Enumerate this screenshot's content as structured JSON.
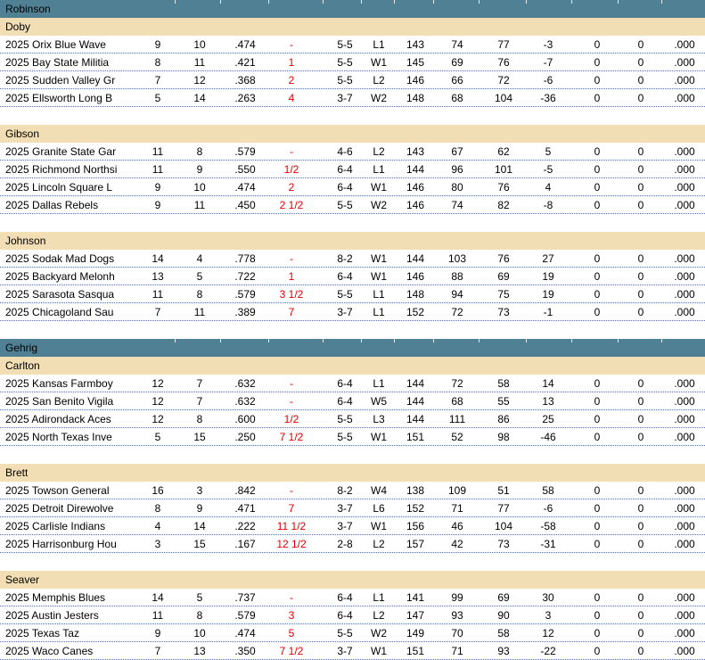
{
  "colors": {
    "league_band": "#4f8094",
    "division_band": "#f2deb4",
    "games_behind": "#e00000",
    "row_separator": "#5b6fb0"
  },
  "leagues": [
    {
      "name": "Robinson",
      "divisions": [
        {
          "name": "Doby",
          "teams": [
            [
              "2025 Orix  Blue Wave",
              "9",
              "10",
              ".474",
              "-",
              "5-5",
              "L1",
              "143",
              "74",
              "77",
              "-3",
              "0",
              "0",
              ".000"
            ],
            [
              "2025 Bay State Militia",
              "8",
              "11",
              ".421",
              "1",
              "5-5",
              "W1",
              "145",
              "69",
              "76",
              "-7",
              "0",
              "0",
              ".000"
            ],
            [
              "2025 Sudden Valley Gr",
              "7",
              "12",
              ".368",
              "2",
              "5-5",
              "L2",
              "146",
              "66",
              "72",
              "-6",
              "0",
              "0",
              ".000"
            ],
            [
              "2025 Ellsworth Long B",
              "5",
              "14",
              ".263",
              "4",
              "3-7",
              "W2",
              "148",
              "68",
              "104",
              "-36",
              "0",
              "0",
              ".000"
            ]
          ]
        },
        {
          "name": "Gibson",
          "teams": [
            [
              "2025 Granite State Gar",
              "11",
              "8",
              ".579",
              "-",
              "4-6",
              "L2",
              "143",
              "67",
              "62",
              "5",
              "0",
              "0",
              ".000"
            ],
            [
              "2025 Richmond Northsi",
              "11",
              "9",
              ".550",
              "1/2",
              "6-4",
              "L1",
              "144",
              "96",
              "101",
              "-5",
              "0",
              "0",
              ".000"
            ],
            [
              "2025 Lincoln Square L",
              "9",
              "10",
              ".474",
              "2",
              "6-4",
              "W1",
              "146",
              "80",
              "76",
              "4",
              "0",
              "0",
              ".000"
            ],
            [
              "2025 Dallas Rebels",
              "9",
              "11",
              ".450",
              "2 1/2",
              "5-5",
              "W2",
              "146",
              "74",
              "82",
              "-8",
              "0",
              "0",
              ".000"
            ]
          ]
        },
        {
          "name": "Johnson",
          "teams": [
            [
              "2025 Sodak Mad Dogs",
              "14",
              "4",
              ".778",
              "-",
              "8-2",
              "W1",
              "144",
              "103",
              "76",
              "27",
              "0",
              "0",
              ".000"
            ],
            [
              "2025 Backyard Melonh",
              "13",
              "5",
              ".722",
              "1",
              "6-4",
              "W1",
              "146",
              "88",
              "69",
              "19",
              "0",
              "0",
              ".000"
            ],
            [
              "2025 Sarasota Sasqua",
              "11",
              "8",
              ".579",
              "3 1/2",
              "5-5",
              "L1",
              "148",
              "94",
              "75",
              "19",
              "0",
              "0",
              ".000"
            ],
            [
              "2025 Chicagoland Sau",
              "7",
              "11",
              ".389",
              "7",
              "3-7",
              "L1",
              "152",
              "72",
              "73",
              "-1",
              "0",
              "0",
              ".000"
            ]
          ]
        }
      ]
    },
    {
      "name": "Gehrig",
      "divisions": [
        {
          "name": "Carlton",
          "teams": [
            [
              "2025 Kansas Farmboy",
              "12",
              "7",
              ".632",
              "-",
              "6-4",
              "L1",
              "144",
              "72",
              "58",
              "14",
              "0",
              "0",
              ".000"
            ],
            [
              "2025 San Benito Vigila",
              "12",
              "7",
              ".632",
              "-",
              "6-4",
              "W5",
              "144",
              "68",
              "55",
              "13",
              "0",
              "0",
              ".000"
            ],
            [
              "2025 Adirondack Aces",
              "12",
              "8",
              ".600",
              "1/2",
              "5-5",
              "L3",
              "144",
              "111",
              "86",
              "25",
              "0",
              "0",
              ".000"
            ],
            [
              "2025 North Texas Inve",
              "5",
              "15",
              ".250",
              "7 1/2",
              "5-5",
              "W1",
              "151",
              "52",
              "98",
              "-46",
              "0",
              "0",
              ".000"
            ]
          ]
        },
        {
          "name": "Brett",
          "teams": [
            [
              "2025 Towson  General",
              "16",
              "3",
              ".842",
              "-",
              "8-2",
              "W4",
              "138",
              "109",
              "51",
              "58",
              "0",
              "0",
              ".000"
            ],
            [
              "2025 Detroit Direwolve",
              "8",
              "9",
              ".471",
              "7",
              "3-7",
              "L6",
              "152",
              "71",
              "77",
              "-6",
              "0",
              "0",
              ".000"
            ],
            [
              "2025 Carlisle Indians",
              "4",
              "14",
              ".222",
              "11 1/2",
              "3-7",
              "W1",
              "156",
              "46",
              "104",
              "-58",
              "0",
              "0",
              ".000"
            ],
            [
              "2025 Harrisonburg Hou",
              "3",
              "15",
              ".167",
              "12 1/2",
              "2-8",
              "L2",
              "157",
              "42",
              "73",
              "-31",
              "0",
              "0",
              ".000"
            ]
          ]
        },
        {
          "name": "Seaver",
          "teams": [
            [
              "2025 Memphis Blues",
              "14",
              "5",
              ".737",
              "-",
              "6-4",
              "L1",
              "141",
              "99",
              "69",
              "30",
              "0",
              "0",
              ".000"
            ],
            [
              "2025 Austin Jesters",
              "11",
              "8",
              ".579",
              "3",
              "6-4",
              "L2",
              "147",
              "93",
              "90",
              "3",
              "0",
              "0",
              ".000"
            ],
            [
              "2025 Texas Taz",
              "9",
              "10",
              ".474",
              "5",
              "5-5",
              "W2",
              "149",
              "70",
              "58",
              "12",
              "0",
              "0",
              ".000"
            ],
            [
              "2025 Waco Canes",
              "7",
              "13",
              ".350",
              "7 1/2",
              "3-7",
              "W1",
              "151",
              "71",
              "93",
              "-22",
              "0",
              "0",
              ".000"
            ]
          ]
        }
      ]
    }
  ]
}
